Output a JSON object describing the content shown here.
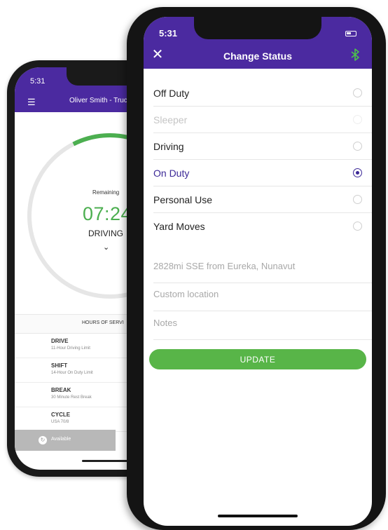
{
  "colors": {
    "header": "#4b2aa0",
    "accent": "#3b2897",
    "green": "#58b548",
    "arc": "#4caf50"
  },
  "back_phone": {
    "time": "5:31",
    "title": "Oliver Smith - Truc",
    "remaining_label": "Remaining",
    "clock": "07:24",
    "mode": "DRIVING",
    "chevron": "⌄",
    "hos_title": "HOURS OF SERVI",
    "hos_rows": [
      {
        "title": "DRIVE",
        "subtitle": "11-Hour Driving Limit"
      },
      {
        "title": "SHIFT",
        "subtitle": "14-Hour On Duty Limit"
      },
      {
        "title": "BREAK",
        "subtitle": "30 Minute Rest Break"
      },
      {
        "title": "CYCLE",
        "subtitle": "USA 70/8"
      }
    ],
    "available_label": "Available"
  },
  "front_phone": {
    "time": "5:31",
    "title": "Change Status",
    "statuses": [
      {
        "label": "Off Duty",
        "state": "normal"
      },
      {
        "label": "Sleeper",
        "state": "disabled"
      },
      {
        "label": "Driving",
        "state": "normal"
      },
      {
        "label": "On Duty",
        "state": "selected"
      },
      {
        "label": "Personal Use",
        "state": "normal"
      },
      {
        "label": "Yard Moves",
        "state": "normal"
      }
    ],
    "location_placeholder": "2828mi SSE from Eureka, Nunavut",
    "custom_location_placeholder": "Custom location",
    "notes_placeholder": "Notes",
    "update_label": "UPDATE"
  }
}
